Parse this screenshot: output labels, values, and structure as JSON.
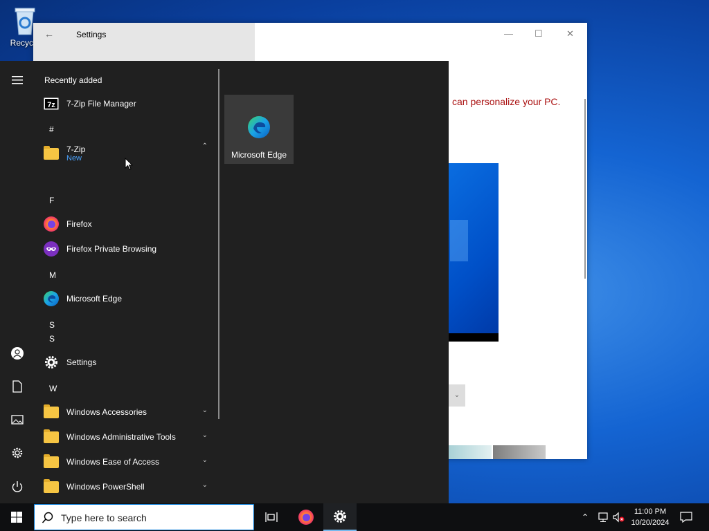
{
  "desktop": {
    "recycle_bin_label": "Recycle"
  },
  "settings_window": {
    "title": "Settings",
    "message": "can personalize your PC.",
    "controls": {
      "minimize": "—",
      "maximize": "☐",
      "close": "✕"
    }
  },
  "start_menu": {
    "recently_added_header": "Recently added",
    "recent_items": [
      {
        "label": "7-Zip File Manager",
        "icon": "7zip-icon"
      }
    ],
    "groups": {
      "hash": "#",
      "f": "F",
      "m": "M",
      "s1": "S",
      "s2": "S",
      "w": "W"
    },
    "apps": {
      "zip_folder": {
        "label": "7-Zip",
        "sub": "New"
      },
      "firefox": "Firefox",
      "firefox_private": "Firefox Private Browsing",
      "edge": "Microsoft Edge",
      "settings": "Settings",
      "win_accessories": "Windows Accessories",
      "win_admin": "Windows Administrative Tools",
      "win_ease": "Windows Ease of Access",
      "win_powershell": "Windows PowerShell"
    },
    "tile": {
      "label": "Microsoft Edge",
      "icon": "edge-icon"
    },
    "rail_icons": [
      "hamburger-icon",
      "user-icon",
      "document-icon",
      "pictures-icon",
      "settings-icon",
      "power-icon"
    ]
  },
  "taskbar": {
    "search_placeholder": "Type here to search",
    "pinned": [
      "task-view-icon",
      "firefox-icon",
      "settings-icon"
    ],
    "clock": {
      "time": "11:00 PM",
      "date": "10/20/2024"
    }
  },
  "colors": {
    "accent": "#0078d7",
    "start_bg": "#202020",
    "taskbar_bg": "#0e0f11",
    "folder": "#f6c543",
    "link_blue": "#4aa3ff"
  }
}
